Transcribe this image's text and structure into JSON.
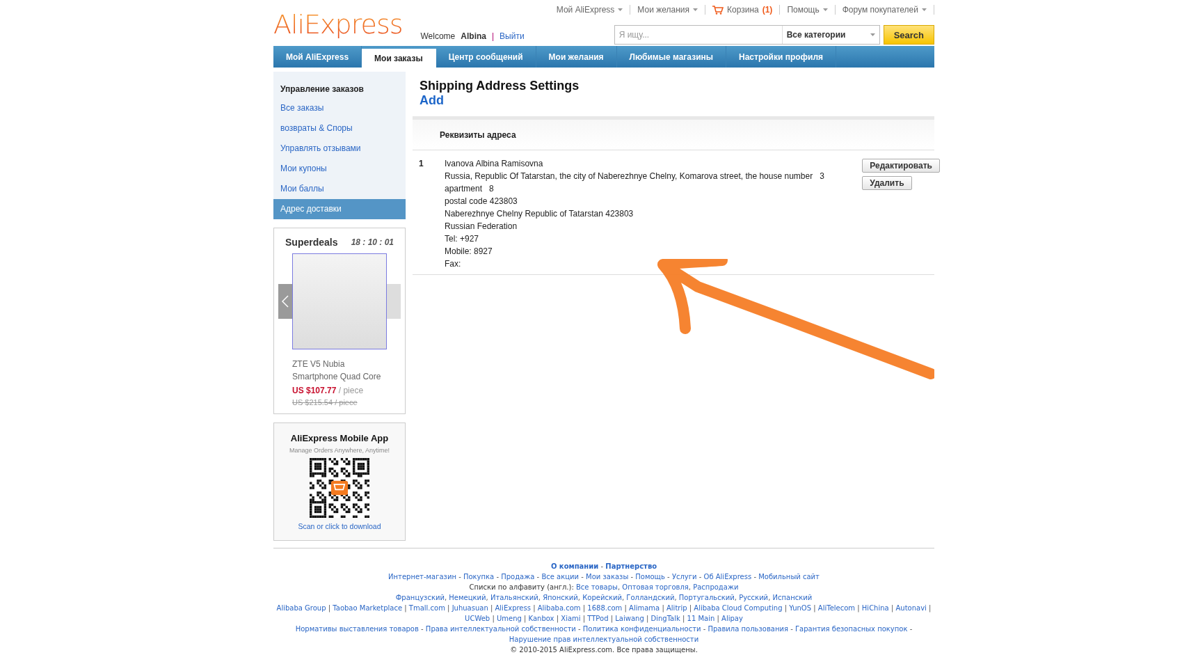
{
  "logo": {
    "text": "AliExpress"
  },
  "top_links": [
    {
      "label": "Мой AliExpress",
      "kind": "dropdown"
    },
    {
      "label": "Мои желания",
      "kind": "dropdown"
    },
    {
      "label": "Корзина",
      "kind": "cart",
      "count": "(1)"
    },
    {
      "label": "Помощь",
      "kind": "dropdown"
    },
    {
      "label": "Форум покупателей",
      "kind": "dropdown"
    }
  ],
  "welcome": {
    "text": "Welcome",
    "user": "Albina",
    "separator": "|",
    "logout": "Выйти"
  },
  "search": {
    "placeholder": "Я ищу...",
    "category": "Все категории",
    "button": "Search"
  },
  "nav_tabs": [
    {
      "label": "Мой AliExpress",
      "selected": false
    },
    {
      "label": "Мои заказы",
      "selected": true
    },
    {
      "label": "Центр сообщений",
      "selected": false
    },
    {
      "label": "Мои желания",
      "selected": false
    },
    {
      "label": "Любимые магазины",
      "selected": false
    },
    {
      "label": "Настройки профиля",
      "selected": false
    }
  ],
  "sidebar": {
    "heading": "Управление заказов",
    "items": [
      {
        "label": "Все заказы",
        "selected": false
      },
      {
        "label": "возвраты & Споры",
        "selected": false
      },
      {
        "label": "Управлять отзывами",
        "selected": false
      },
      {
        "label": "Мои купоны",
        "selected": false
      },
      {
        "label": "Мои баллы",
        "selected": false
      },
      {
        "label": "Адрес доставки",
        "selected": true
      }
    ]
  },
  "superdeals": {
    "title": "Superdeals",
    "timer": "18 : 10 : 01",
    "product_name": "ZTE V5 Nubia Smartphone Quad Core",
    "price": "US $107.77",
    "unit": "/ piece",
    "old_price": "US $215.54 / piece"
  },
  "mobile_app": {
    "title": "AliExpress Mobile App",
    "subtitle": "Manage Orders Anywhere, Anytime!",
    "link": "Scan or click to download"
  },
  "main": {
    "title": "Shipping Address Settings",
    "add_link": "Add",
    "table_header": "Реквизиты адреса",
    "addresses": [
      {
        "index": "1",
        "lines": [
          "Ivanova Albina Ramisovna",
          "Russia, Republic Of Tatarstan, the city of Naberezhnye Chelny, Komarova street, the house number   3",
          "apartment   8",
          "postal code 423803",
          "Naberezhnye Chelny Republic of Tatarstan 423803",
          "Russian Federation",
          "Tel: +927",
          "Mobile: 8927",
          "Fax:"
        ],
        "actions": [
          "Редактировать",
          "Удалить"
        ]
      }
    ]
  },
  "footer": {
    "lines": [
      {
        "kind": "bold",
        "separator": "-",
        "links": [
          "О компании",
          "Партнерство"
        ]
      },
      {
        "kind": "links",
        "separator": "-",
        "links": [
          "Интернет-магазин",
          "Покупка",
          "Продажа",
          "Все акции",
          "Мои заказы",
          "Помощь",
          "Услуги",
          "Об AliExpress",
          "Мобильный сайт"
        ]
      },
      {
        "kind": "links",
        "prefix": "Списки по алфавиту (англ.):",
        "separator": ",",
        "links": [
          "Все товары",
          "Оптовая торговля",
          "Распродажи"
        ]
      },
      {
        "kind": "links",
        "separator": ",",
        "links": [
          "Французский",
          "Немецкий",
          "Итальянский",
          "Японский",
          "Корейский",
          "Голландский",
          "Португальский",
          "Русский",
          "Испанский"
        ]
      },
      {
        "kind": "links",
        "separator": "|",
        "links": [
          "Alibaba Group",
          "Taobao Marketplace",
          "Tmall.com",
          "Juhuasuan",
          "AliExpress",
          "Alibaba.com",
          "1688.com",
          "Alimama",
          "Alitrip",
          "Alibaba Cloud Computing",
          "YunOS",
          "AliTelecom",
          "HiChina",
          "Autonavi",
          "UCWeb",
          "Umeng",
          "Kanbox",
          "Xiami",
          "TTPod",
          "Laiwang",
          "DingTalk",
          "11 Main",
          "Alipay"
        ]
      },
      {
        "kind": "links",
        "separator": "-",
        "links": [
          "Нормативы выставления товаров",
          "Права интеллектуальной собственности",
          "Политика конфиденциальности",
          "Правила пользования",
          "Гарантия безопасных покупок",
          "Нарушение прав интеллектуальной собственности"
        ]
      },
      {
        "kind": "plain",
        "text": "© 2010-2015 AliExpress.com. Все права защищены."
      }
    ]
  }
}
